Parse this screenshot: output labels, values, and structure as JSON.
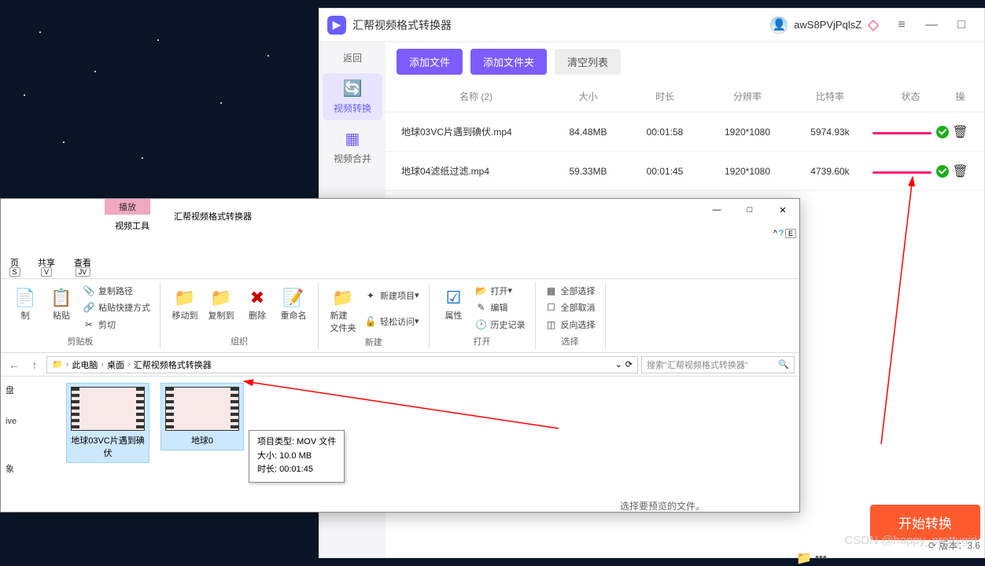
{
  "converter": {
    "title": "汇帮视频格式转换器",
    "username": "awS8PVjPqlsZ",
    "back": "返回",
    "tabs": {
      "convert": "视频转换",
      "merge": "视频合并"
    },
    "toolbar": {
      "add_file": "添加文件",
      "add_folder": "添加文件夹",
      "clear": "清空列表"
    },
    "columns": {
      "name": "名称 (2)",
      "size": "大小",
      "duration": "时长",
      "resolution": "分辨率",
      "bitrate": "比特率",
      "status": "状态",
      "operation": "操"
    },
    "rows": [
      {
        "name": "地球03VC片遇到碘伏.mp4",
        "size": "84.48MB",
        "duration": "00:01:58",
        "resolution": "1920*1080",
        "bitrate": "5974.93k"
      },
      {
        "name": "地球04滤纸过滤.mp4",
        "size": "59.33MB",
        "duration": "00:01:45",
        "resolution": "1920*1080",
        "bitrate": "4739.60k"
      }
    ],
    "start": "开始转换",
    "version": "版本：3.6",
    "dots": "•••"
  },
  "explorer": {
    "play_tab": "播放",
    "video_tools": "视频工具",
    "title": "汇帮视频格式转换器",
    "tabs": {
      "page": "页",
      "share": "共享",
      "view": "查看"
    },
    "keys": {
      "page": "S",
      "share": "V",
      "view": "JV"
    },
    "ribbon": {
      "clipboard": {
        "label": "剪贴板",
        "copy": "制",
        "paste": "粘贴",
        "copy_path": "复制路径",
        "paste_shortcut": "粘贴快捷方式",
        "cut": "剪切"
      },
      "organize": {
        "label": "组织",
        "move": "移动到",
        "copy": "复制到",
        "delete": "删除",
        "rename": "重命名"
      },
      "new": {
        "label": "新建",
        "folder": "新建\n文件夹",
        "new_item": "新建项目",
        "easy_access": "轻松访问"
      },
      "open": {
        "label": "打开",
        "props": "属性",
        "open": "打开",
        "edit": "编辑",
        "history": "历史记录"
      },
      "select": {
        "label": "选择",
        "all": "全部选择",
        "none": "全部取消",
        "invert": "反向选择"
      }
    },
    "breadcrumb": {
      "pc": "此电脑",
      "desktop": "桌面",
      "folder": "汇帮视频格式转换器"
    },
    "search_placeholder": "搜索\"汇帮视频格式转换器\"",
    "tree": {
      "disk": "盘",
      "ive": "ive",
      "img": "象"
    },
    "files": [
      {
        "name": "地球03VC片遇到碘伏"
      },
      {
        "name": "地球0"
      }
    ],
    "tooltip": {
      "line1": "项目类型: MOV 文件",
      "line2": "大小: 10.0 MB",
      "line3": "时长: 00:01:45"
    },
    "preview_msg": "选择要预览的文件。",
    "help_key": "E"
  },
  "watermark": "CSDN @happy_prettygirl"
}
